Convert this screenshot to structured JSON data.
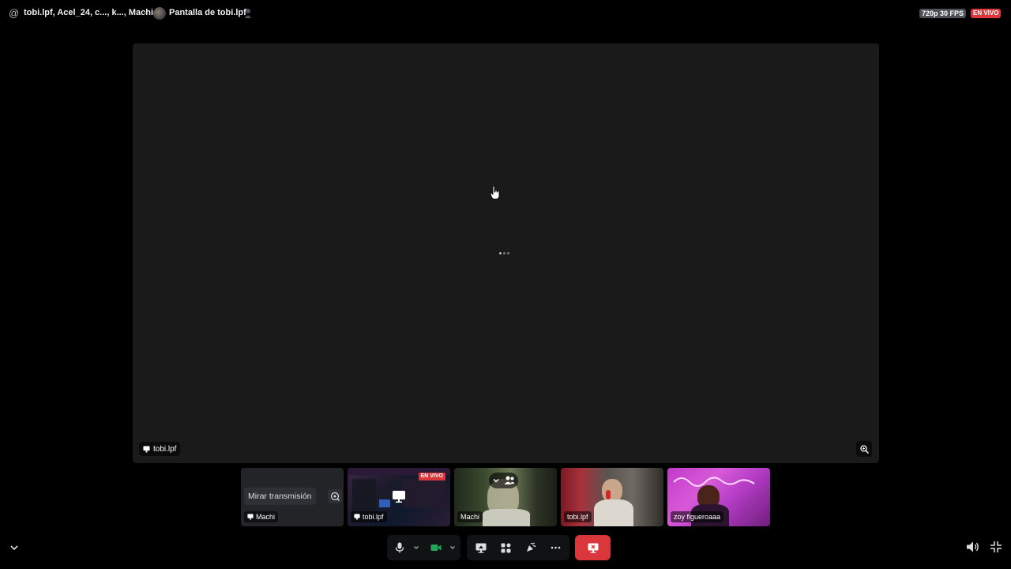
{
  "header": {
    "call_title": "tobi.lpf, Acel_24, c..., k..., Machi",
    "stream_title": "Pantalla de tobi.lpf",
    "quality": "720p 30 FPS",
    "live_label": "EN VIVO"
  },
  "stage": {
    "streamer_label": "tobi.lpf"
  },
  "participants": [
    {
      "name": "Machi",
      "action_label": "Mirar transmisión"
    },
    {
      "name": "tobi.lpf",
      "live_label": "EN VIVO"
    },
    {
      "name": "Machi"
    },
    {
      "name": "tobi.lpf"
    },
    {
      "name": "zoy figueroaaa"
    }
  ],
  "colors": {
    "danger": "#da373c",
    "camera_on": "#23a55a",
    "background": "#000000",
    "stage": "#1a1a1b"
  },
  "icons": {
    "top_left": "at-icon",
    "mic": "microphone-icon",
    "camera": "video-camera-icon",
    "share": "screen-share-icon",
    "activities": "activities-icon",
    "soundboard": "soundboard-icon",
    "more": "more-icon",
    "leave": "leave-stream-icon",
    "volume": "volume-icon",
    "fullscreen": "exit-fullscreen-icon"
  }
}
